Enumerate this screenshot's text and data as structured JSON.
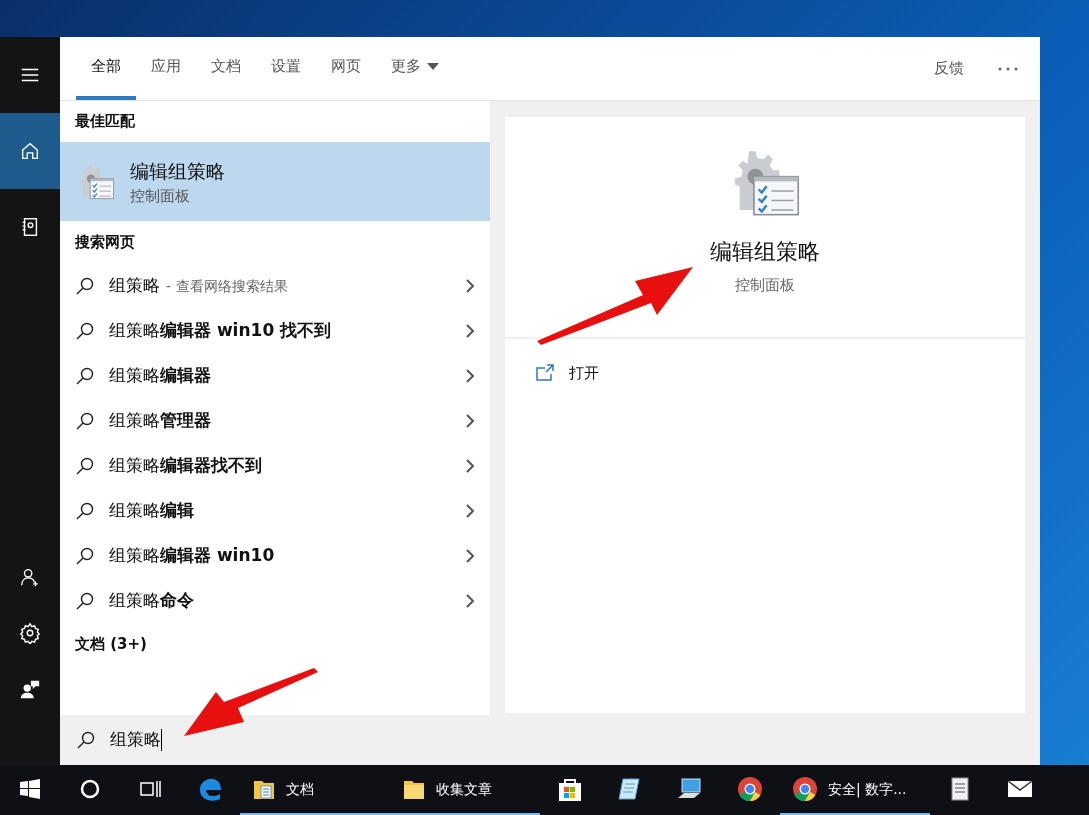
{
  "rail": {
    "top": [
      {
        "kind": "menu",
        "selected": false
      },
      {
        "kind": "home",
        "selected": true
      },
      {
        "kind": "notebook",
        "selected": false
      }
    ],
    "bottom": [
      {
        "kind": "add-user",
        "selected": false
      },
      {
        "kind": "settings",
        "selected": false
      },
      {
        "kind": "feedback",
        "selected": false
      }
    ]
  },
  "tabs": [
    {
      "label": "全部",
      "selected": true
    },
    {
      "label": "应用",
      "selected": false
    },
    {
      "label": "文档",
      "selected": false
    },
    {
      "label": "设置",
      "selected": false
    },
    {
      "label": "网页",
      "selected": false
    },
    {
      "label": "更多",
      "selected": false,
      "dropdown": true
    }
  ],
  "feedback": "反馈",
  "best_match": {
    "header": "最佳匹配",
    "title": "编辑组策略",
    "subtitle": "控制面板",
    "selected": true
  },
  "web": {
    "header": "搜索网页",
    "results": [
      {
        "text": "组策略",
        "hint": "- 查看网络搜索结果"
      },
      {
        "text": "组策略**编辑器 win10 找不到**"
      },
      {
        "text": "组策略**编辑器**"
      },
      {
        "text": "组策略**管理器**"
      },
      {
        "text": "组策略**编辑器找不到**"
      },
      {
        "text": "组策略**编辑**"
      },
      {
        "text": "组策略**编辑器 win10**"
      },
      {
        "text": "组策略**命令**"
      }
    ]
  },
  "documents": {
    "header": "文档 (3+)"
  },
  "preview": {
    "title": "编辑组策略",
    "subtitle": "控制面板",
    "actions": [
      {
        "label": "打开"
      }
    ]
  },
  "search": {
    "value": "组策略"
  },
  "taskbar": [
    {
      "kind": "start",
      "running": false
    },
    {
      "kind": "cortana",
      "running": false
    },
    {
      "kind": "task-view",
      "running": false
    },
    {
      "kind": "edge",
      "running": false
    },
    {
      "kind": "folder-doc",
      "label": "文档",
      "running": true
    },
    {
      "kind": "folder",
      "label": "收集文章",
      "running": true
    },
    {
      "kind": "store",
      "running": false
    },
    {
      "kind": "notepad",
      "running": false
    },
    {
      "kind": "computer",
      "running": false
    },
    {
      "kind": "chrome",
      "running": false
    },
    {
      "kind": "chrome",
      "label": "安全| 数字...",
      "running": true
    },
    {
      "kind": "document",
      "running": false
    },
    {
      "kind": "mail",
      "running": false
    }
  ]
}
